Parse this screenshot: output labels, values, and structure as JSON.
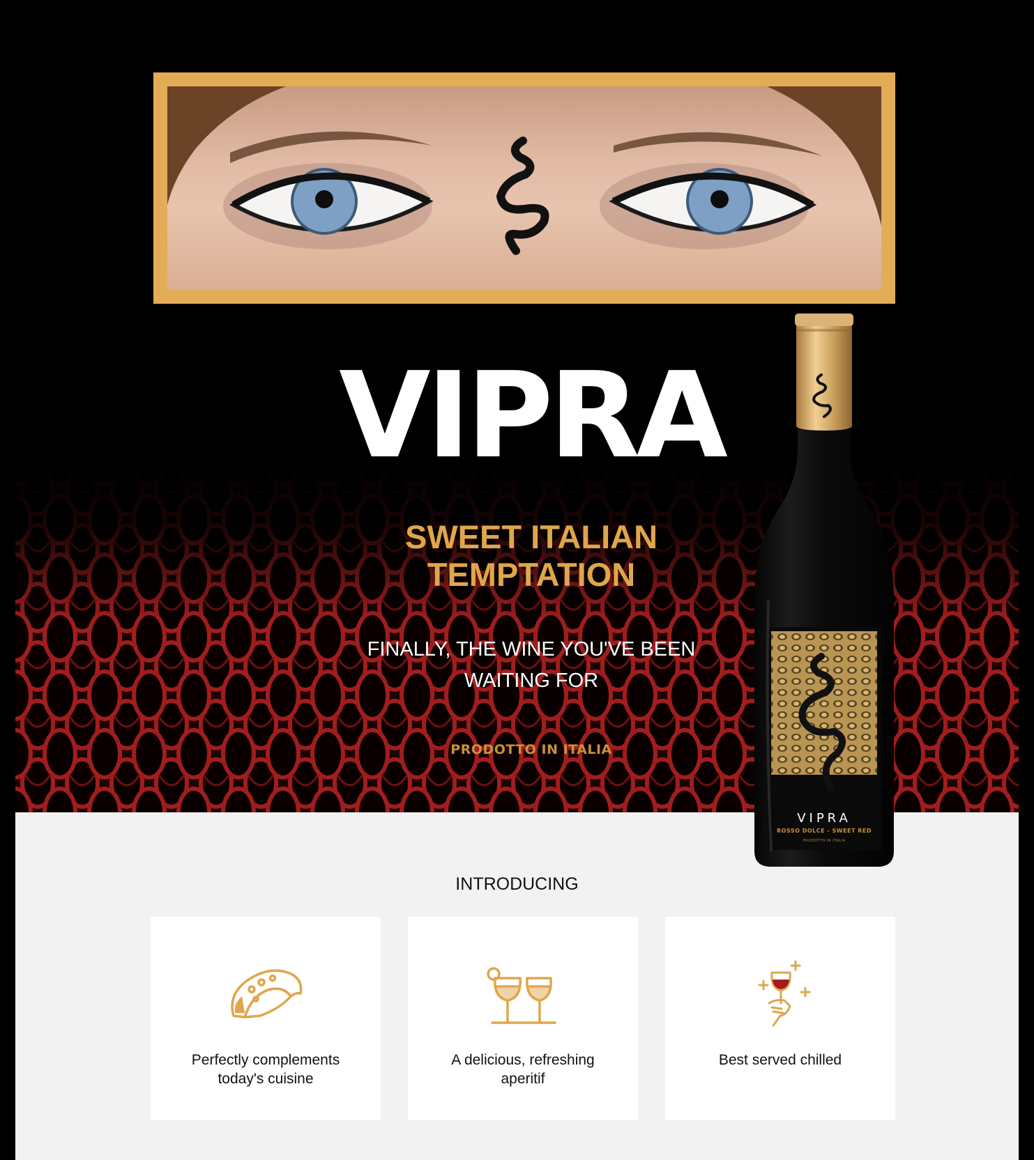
{
  "hero": {
    "brand": "VIPRA",
    "tagline_line1": "SWEET ITALIAN",
    "tagline_line2": "TEMPTATION",
    "subline_line1": "FINALLY, THE WINE YOU'VE BEEN",
    "subline_line2": "WAITING FOR",
    "made_in": "PRODOTTO IN ITALIA",
    "accent_color": "#e0a64b"
  },
  "bottle": {
    "brand": "VIPRA",
    "variety": "ROSSO DOLCE - SWEET RED",
    "origin": "PRODOTTO IN ITALIA"
  },
  "intro": {
    "heading": "INTRODUCING",
    "cards": [
      {
        "icon": "taco-icon",
        "line1": "Perfectly complements",
        "line2": "today's cuisine"
      },
      {
        "icon": "wine-glasses-icon",
        "line1": "A delicious, refreshing",
        "line2": "aperitif"
      },
      {
        "icon": "chilled-glass-icon",
        "line1": "Best served chilled",
        "line2": ""
      }
    ]
  }
}
